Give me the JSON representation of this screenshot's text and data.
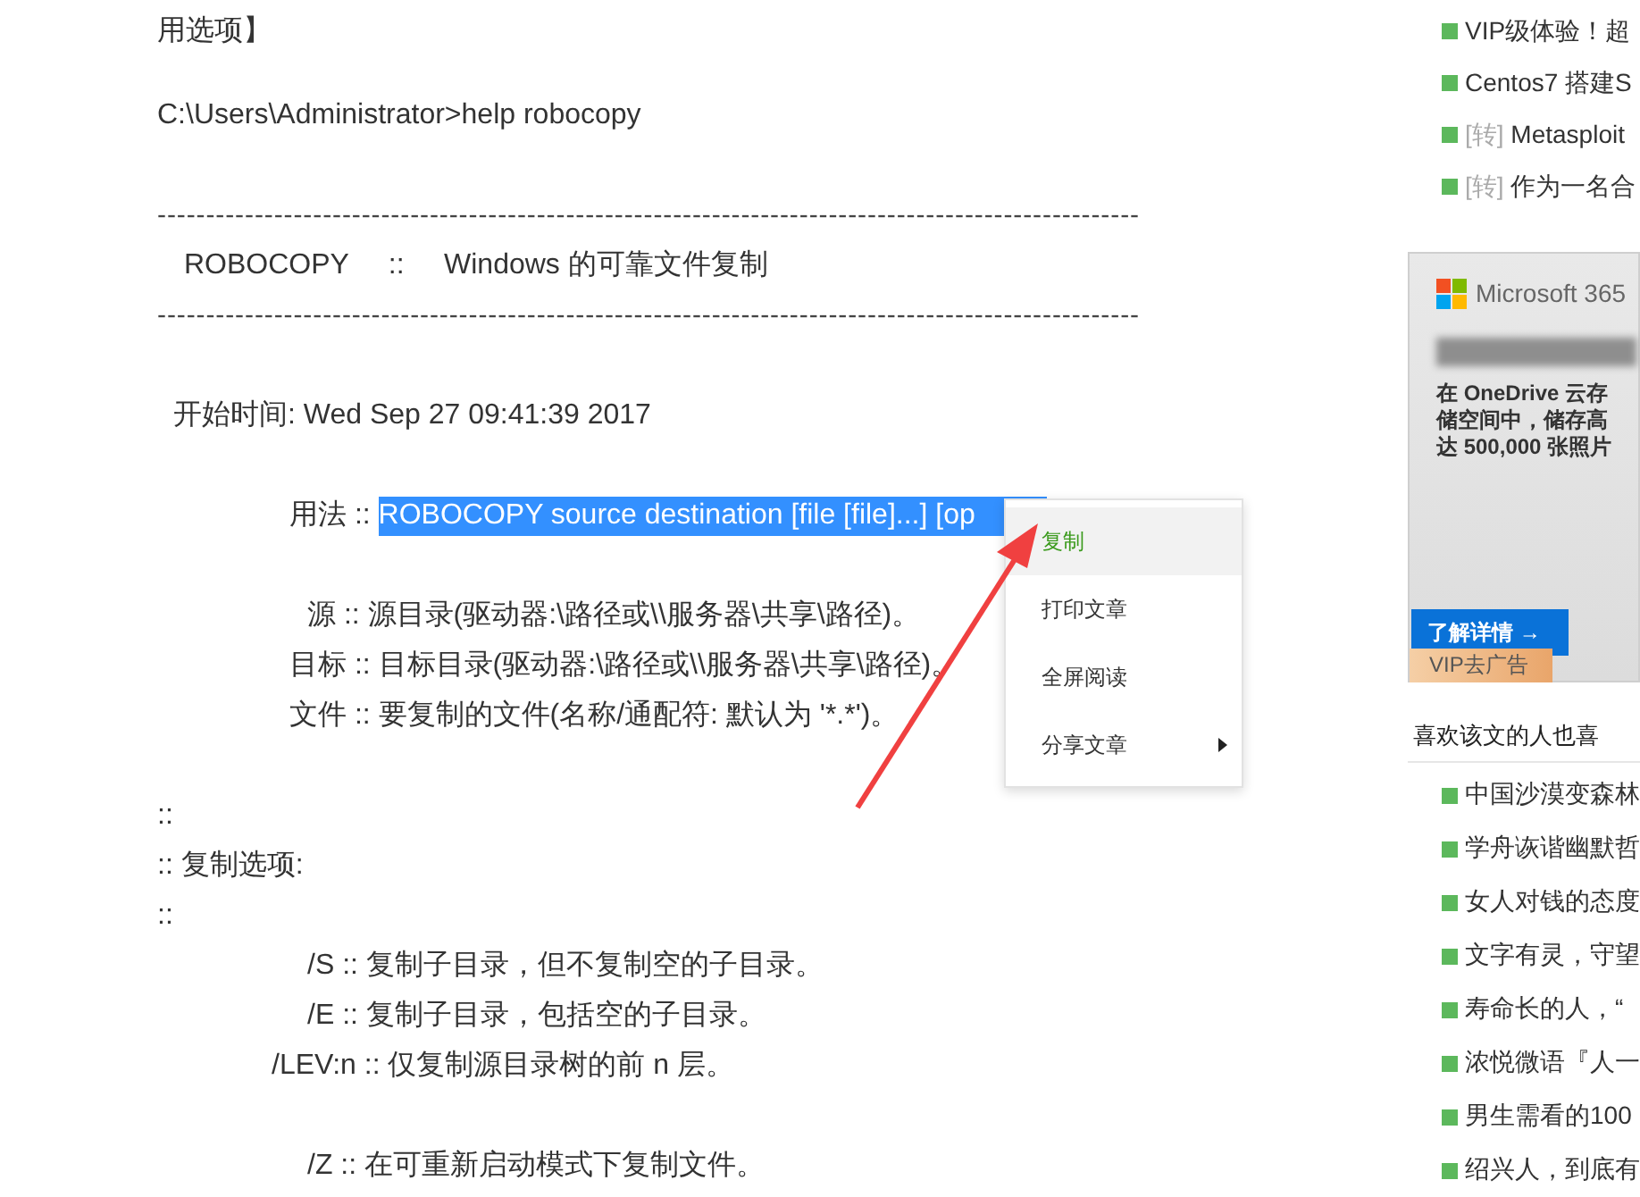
{
  "article": {
    "lines": [
      {
        "kind": "text",
        "text": "用选项】"
      },
      {
        "kind": "spacer"
      },
      {
        "kind": "text",
        "text": "C:\\Users\\Administrator>help robocopy"
      },
      {
        "kind": "blank"
      },
      {
        "kind": "rule",
        "text": "-----------------------------------------------------------------------------------------------------"
      },
      {
        "kind": "title",
        "text": "ROBOCOPY     ::     Windows 的可靠文件复制"
      },
      {
        "kind": "rule",
        "text": "-----------------------------------------------------------------------------------------------------"
      },
      {
        "kind": "blank"
      },
      {
        "kind": "lead",
        "text": "开始时间: Wed Sep 27 09:41:39 2017"
      },
      {
        "kind": "blank"
      },
      {
        "kind": "usage",
        "text": "用法 :: ",
        "selection": "ROBOCOPY source destination [file [file]...] [op"
      },
      {
        "kind": "blank"
      },
      {
        "kind": "source",
        "text": "源 :: 源目录(驱动器:\\路径或\\\\服务器\\共享\\路径)。"
      },
      {
        "kind": "usage",
        "text": "目标 :: 目标目录(驱动器:\\路径或\\\\服务器\\共享\\路径)。"
      },
      {
        "kind": "usage",
        "text": "文件 :: 要复制的文件(名称/通配符: 默认为 '*.*')。"
      },
      {
        "kind": "blank"
      },
      {
        "kind": "text",
        "text": "::"
      },
      {
        "kind": "text",
        "text": ":: 复制选项:"
      },
      {
        "kind": "text",
        "text": "::"
      },
      {
        "kind": "option",
        "text": "/S :: 复制子目录，但不复制空的子目录。"
      },
      {
        "kind": "option",
        "text": "/E :: 复制子目录，包括空的子目录。"
      },
      {
        "kind": "option-long",
        "text": "/LEV:n :: 仅复制源目录树的前 n 层。"
      },
      {
        "kind": "blank"
      },
      {
        "kind": "option",
        "text": "/Z :: 在可重新启动模式下复制文件。"
      }
    ]
  },
  "context_menu": {
    "items": [
      {
        "label": "复制",
        "highlighted": true,
        "has_submenu": false
      },
      {
        "label": "打印文章",
        "highlighted": false,
        "has_submenu": false
      },
      {
        "label": "全屏阅读",
        "highlighted": false,
        "has_submenu": false
      },
      {
        "label": "分享文章",
        "highlighted": false,
        "has_submenu": true
      }
    ]
  },
  "sidebar": {
    "top_links": [
      {
        "title": "VIP级体验！超"
      },
      {
        "title": "Centos7 搭建S"
      },
      {
        "tag": "[转]",
        "title": "Metasploit"
      },
      {
        "tag": "[转]",
        "title": "作为一名合"
      }
    ],
    "ad": {
      "brand": "Microsoft 365",
      "body": "在 OneDrive 云存储空间中，储存高达 500,000 张照片",
      "cta": "了解详情 →",
      "remove_ad": "VIP去广告"
    },
    "related": {
      "heading": "喜欢该文的人也喜",
      "items": [
        "中国沙漠变森林",
        "学舟诙谐幽默哲",
        "女人对钱的态度",
        "文字有灵，守望",
        "寿命长的人，“",
        "浓悦微语『人一",
        "男生需看的100",
        "绍兴人，到底有"
      ]
    }
  }
}
